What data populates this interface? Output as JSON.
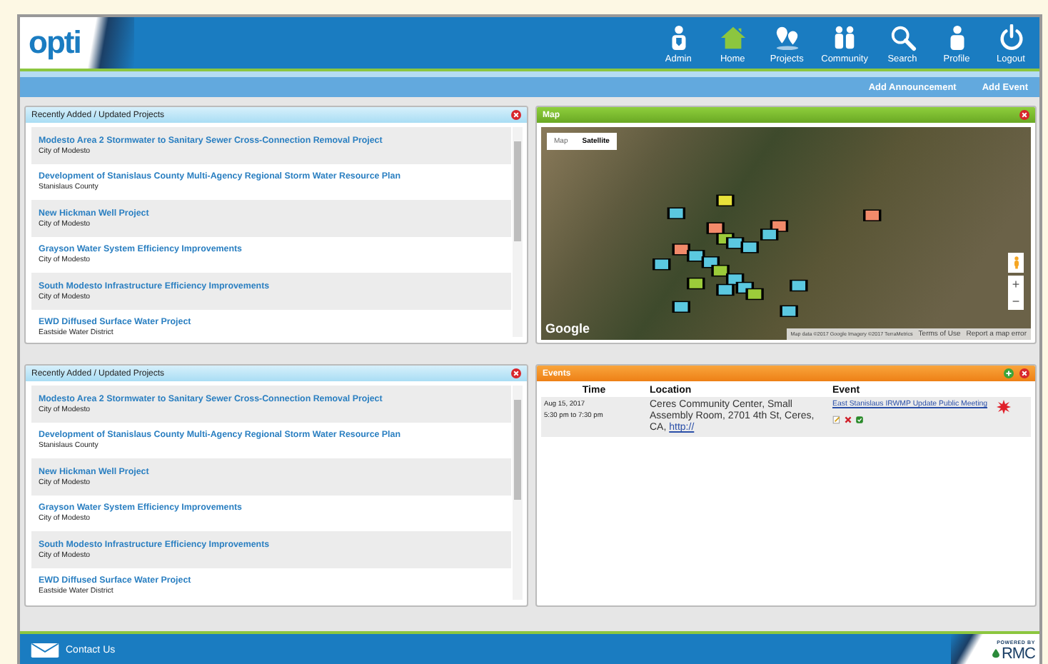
{
  "header": {
    "logo": "opti",
    "nav": [
      {
        "label": "Admin",
        "kind": "admin",
        "selected": false
      },
      {
        "label": "Home",
        "kind": "home",
        "selected": true
      },
      {
        "label": "Projects",
        "kind": "projects",
        "selected": false
      },
      {
        "label": "Community",
        "kind": "community",
        "selected": false
      },
      {
        "label": "Search",
        "kind": "search",
        "selected": false
      },
      {
        "label": "Profile",
        "kind": "profile",
        "selected": false
      },
      {
        "label": "Logout",
        "kind": "logout",
        "selected": false
      }
    ]
  },
  "action_bar": {
    "links": [
      "Add Announcement",
      "Add Event"
    ]
  },
  "project_panels": [
    {
      "title": "Recently Added / Updated Projects",
      "items": [
        {
          "title": "Modesto Area 2 Stormwater to Sanitary Sewer Cross-Connection Removal Project",
          "agency": "City of Modesto"
        },
        {
          "title": "Development of Stanislaus County Multi-Agency Regional Storm Water Resource Plan",
          "agency": "Stanislaus County"
        },
        {
          "title": "New Hickman Well Project",
          "agency": "City of Modesto"
        },
        {
          "title": "Grayson Water System Efficiency Improvements",
          "agency": "City of Modesto"
        },
        {
          "title": "South Modesto Infrastructure Efficiency Improvements",
          "agency": "City of Modesto"
        },
        {
          "title": "EWD Diffused Surface Water Project",
          "agency": "Eastside Water District"
        }
      ]
    },
    {
      "title": "Recently Added / Updated Projects",
      "items": [
        {
          "title": "Modesto Area 2 Stormwater to Sanitary Sewer Cross-Connection Removal Project",
          "agency": "City of Modesto"
        },
        {
          "title": "Development of Stanislaus County Multi-Agency Regional Storm Water Resource Plan",
          "agency": "Stanislaus County"
        },
        {
          "title": "New Hickman Well Project",
          "agency": "City of Modesto"
        },
        {
          "title": "Grayson Water System Efficiency Improvements",
          "agency": "City of Modesto"
        },
        {
          "title": "South Modesto Infrastructure Efficiency Improvements",
          "agency": "City of Modesto"
        },
        {
          "title": "EWD Diffused Surface Water Project",
          "agency": "Eastside Water District"
        }
      ]
    }
  ],
  "map": {
    "title": "Map",
    "map_types": [
      {
        "label": "Map",
        "selected": false
      },
      {
        "label": "Satellite",
        "selected": true
      }
    ],
    "logo": "Google",
    "zoom": [
      "+",
      "−"
    ],
    "attribution": "Map data ©2017 Google Imagery ©2017 TerraMetrics",
    "links": [
      "Terms of Use",
      "Report a map error"
    ]
  },
  "events": {
    "title": "Events",
    "columns": [
      "Time",
      "Location",
      "Event"
    ],
    "rows": [
      {
        "date": "Aug 15, 2017",
        "hours": "5:30 pm to 7:30 pm",
        "location": "Ceres Community Center, Small Assembly Room, 2701 4th St, Ceres, CA,",
        "location_link": "http://",
        "event": "East Stanislaus IRWMP Update Public Meeting"
      }
    ]
  },
  "footer": {
    "contact": "Contact Us",
    "powered_by": "POWERED BY",
    "brand": "RMC"
  }
}
